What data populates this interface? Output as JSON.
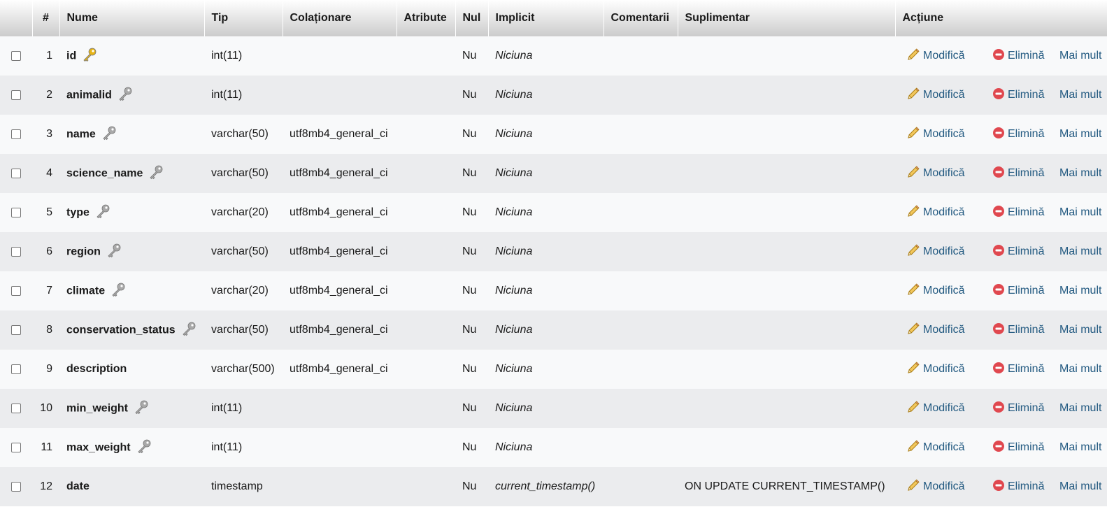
{
  "headers": {
    "num": "#",
    "name": "Nume",
    "type": "Tip",
    "collation": "Colaționare",
    "attributes": "Atribute",
    "null": "Nul",
    "default": "Implicit",
    "comments": "Comentarii",
    "extra": "Suplimentar",
    "action": "Acțiune"
  },
  "actions": {
    "edit": "Modifică",
    "drop": "Elimină",
    "more": "Mai mult"
  },
  "rows": [
    {
      "num": "1",
      "name": "id",
      "key": "primary-key-icon",
      "type": "int(11)",
      "collation": "",
      "attributes": "",
      "null": "Nu",
      "default": "Niciuna",
      "comments": "",
      "extra": ""
    },
    {
      "num": "2",
      "name": "animalid",
      "key": "index-key-icon",
      "type": "int(11)",
      "collation": "",
      "attributes": "",
      "null": "Nu",
      "default": "Niciuna",
      "comments": "",
      "extra": ""
    },
    {
      "num": "3",
      "name": "name",
      "key": "index-key-icon",
      "type": "varchar(50)",
      "collation": "utf8mb4_general_ci",
      "attributes": "",
      "null": "Nu",
      "default": "Niciuna",
      "comments": "",
      "extra": ""
    },
    {
      "num": "4",
      "name": "science_name",
      "key": "index-key-icon",
      "type": "varchar(50)",
      "collation": "utf8mb4_general_ci",
      "attributes": "",
      "null": "Nu",
      "default": "Niciuna",
      "comments": "",
      "extra": ""
    },
    {
      "num": "5",
      "name": "type",
      "key": "index-key-icon",
      "type": "varchar(20)",
      "collation": "utf8mb4_general_ci",
      "attributes": "",
      "null": "Nu",
      "default": "Niciuna",
      "comments": "",
      "extra": ""
    },
    {
      "num": "6",
      "name": "region",
      "key": "index-key-icon",
      "type": "varchar(50)",
      "collation": "utf8mb4_general_ci",
      "attributes": "",
      "null": "Nu",
      "default": "Niciuna",
      "comments": "",
      "extra": ""
    },
    {
      "num": "7",
      "name": "climate",
      "key": "index-key-icon",
      "type": "varchar(20)",
      "collation": "utf8mb4_general_ci",
      "attributes": "",
      "null": "Nu",
      "default": "Niciuna",
      "comments": "",
      "extra": ""
    },
    {
      "num": "8",
      "name": "conservation_status",
      "key": "index-key-icon",
      "type": "varchar(50)",
      "collation": "utf8mb4_general_ci",
      "attributes": "",
      "null": "Nu",
      "default": "Niciuna",
      "comments": "",
      "extra": ""
    },
    {
      "num": "9",
      "name": "description",
      "key": "",
      "type": "varchar(500)",
      "collation": "utf8mb4_general_ci",
      "attributes": "",
      "null": "Nu",
      "default": "Niciuna",
      "comments": "",
      "extra": ""
    },
    {
      "num": "10",
      "name": "min_weight",
      "key": "index-key-icon",
      "type": "int(11)",
      "collation": "",
      "attributes": "",
      "null": "Nu",
      "default": "Niciuna",
      "comments": "",
      "extra": ""
    },
    {
      "num": "11",
      "name": "max_weight",
      "key": "index-key-icon",
      "type": "int(11)",
      "collation": "",
      "attributes": "",
      "null": "Nu",
      "default": "Niciuna",
      "comments": "",
      "extra": ""
    },
    {
      "num": "12",
      "name": "date",
      "key": "",
      "type": "timestamp",
      "collation": "",
      "attributes": "",
      "null": "Nu",
      "default": "current_timestamp()",
      "comments": "",
      "extra": "ON UPDATE CURRENT_TIMESTAMP()"
    }
  ],
  "colors": {
    "link": "#235a81",
    "primary_key": "#e7b416",
    "index_key": "#a9a9a9",
    "drop_icon": "#e0484f"
  }
}
